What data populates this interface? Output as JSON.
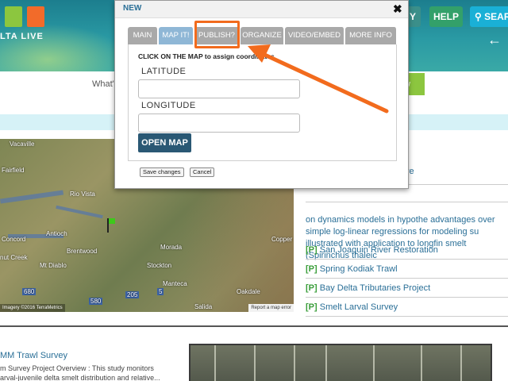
{
  "header": {
    "logo_text": "LTA LIVE",
    "btn_y": "Y",
    "help": "HELP",
    "search": "SEAR",
    "search_icon": "search-icon",
    "back_icon": "arrow-left-icon"
  },
  "nav": {
    "label": "What'",
    "green_tab": "w"
  },
  "map": {
    "labels": {
      "vacaville": "Vacaville",
      "fairfield": "Fairfield",
      "rio_vista": "Rio Vista",
      "concord": "Concord",
      "antioch": "Antioch",
      "brentwood": "Brentwood",
      "nut_creek": "nut Creek",
      "mt_diablo": "Mt Diablo",
      "morada": "Morada",
      "stockton": "Stockton",
      "manteca": "Manteca",
      "oakdale": "Oakdale",
      "salida": "Salida",
      "copperopolis": "Copper"
    },
    "highway_labels": [
      "680",
      "580",
      "205",
      "5"
    ],
    "imagery": "Imagery ©2016 TerraMetrics",
    "report": "Report a map error"
  },
  "right_column": {
    "top_text": "ve",
    "paragraph": "on dynamics models in hypothe advantages over simple log-linear regressions for modeling su illustrated with application to longfin smelt (Spirinchus thaleic",
    "items": [
      {
        "tag": "[P]",
        "label": "San Joaquin River Restoration"
      },
      {
        "tag": "[P]",
        "label": "Spring Kodiak Trawl"
      },
      {
        "tag": "[P]",
        "label": "Bay Delta Tributaries Project"
      },
      {
        "tag": "[P]",
        "label": "Smelt Larval Survey"
      }
    ]
  },
  "bottom": {
    "title": "MM Trawl Survey",
    "subtitle": "m Survey Project Overview : This study monitors arval-juvenile delta smelt distribution and relative..."
  },
  "modal": {
    "title": "NEW",
    "close_glyph": "✖",
    "tabs": [
      {
        "label": "MAIN",
        "active": false
      },
      {
        "label": "MAP IT!",
        "active": true
      },
      {
        "label": "PUBLISH?",
        "active": false
      },
      {
        "label": "ORGANIZE",
        "active": false
      },
      {
        "label": "VIDEO/EMBED",
        "active": false
      },
      {
        "label": "MORE INFO",
        "active": false
      }
    ],
    "instruction": "CLICK ON THE MAP to assign coordinates",
    "latitude_label": "LATITUDE",
    "latitude_value": "",
    "longitude_label": "LONGITUDE",
    "longitude_value": "",
    "open_map": "OPEN MAP",
    "save_changes": "Save changes",
    "cancel": "Cancel"
  },
  "colors": {
    "annotation": "#f26b1d",
    "link": "#2a6f97",
    "active_tab": "#8fb7d6",
    "open_map_bg": "#2a5874"
  }
}
